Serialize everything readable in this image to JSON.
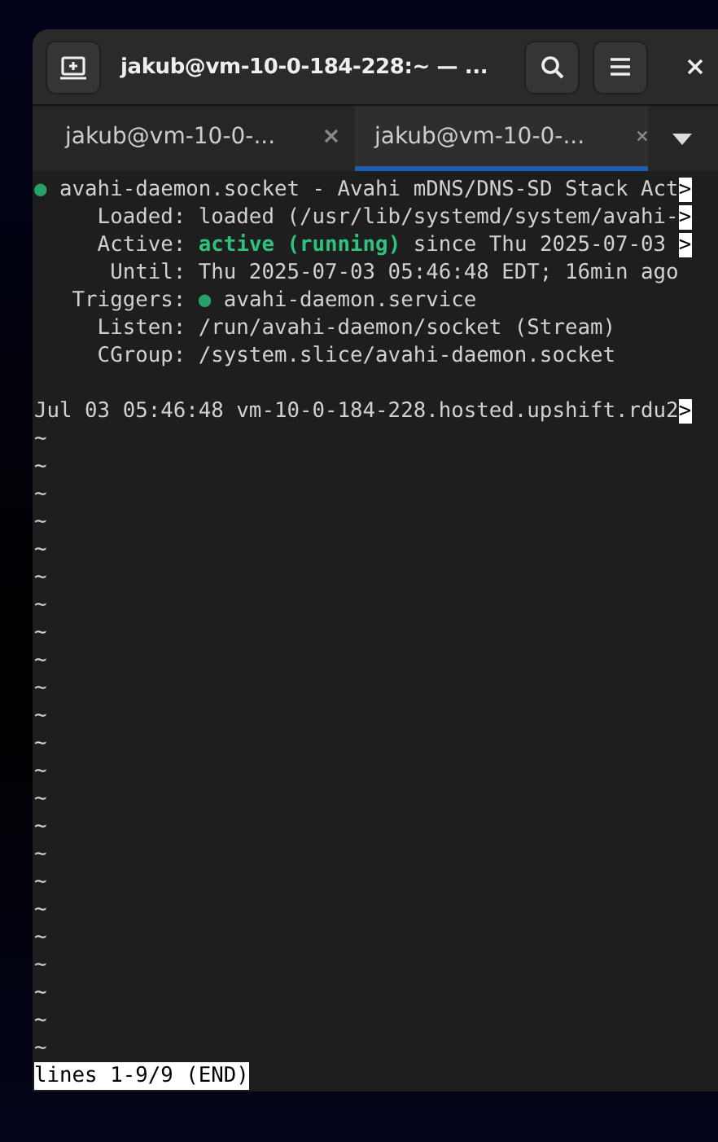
{
  "window": {
    "title": "jakub@vm-10-0-184-228:~ — ..."
  },
  "tabs": [
    {
      "label": "jakub@vm-10-0-...",
      "selected": false
    },
    {
      "label": "jakub@vm-10-0-...",
      "selected": true
    }
  ],
  "terminal": {
    "lines": [
      {
        "segments": [
          {
            "kind": "bullet",
            "text": "●"
          },
          {
            "kind": "plain",
            "text": " avahi-daemon.socket - Avahi mDNS/DNS-SD Stack Act"
          },
          {
            "kind": "marker",
            "text": ">"
          }
        ]
      },
      {
        "segments": [
          {
            "kind": "plain",
            "text": "     Loaded: loaded (/usr/lib/systemd/system/avahi-"
          },
          {
            "kind": "marker",
            "text": ">"
          }
        ]
      },
      {
        "segments": [
          {
            "kind": "plain",
            "text": "     Active: "
          },
          {
            "kind": "status",
            "text": "active (running)"
          },
          {
            "kind": "plain",
            "text": " since Thu 2025-07-03 "
          },
          {
            "kind": "marker",
            "text": ">"
          }
        ]
      },
      {
        "segments": [
          {
            "kind": "plain",
            "text": "      Until: Thu 2025-07-03 05:46:48 EDT; 16min ago"
          }
        ]
      },
      {
        "segments": [
          {
            "kind": "plain",
            "text": "   Triggers: "
          },
          {
            "kind": "bullet",
            "text": "●"
          },
          {
            "kind": "plain",
            "text": " avahi-daemon.service"
          }
        ]
      },
      {
        "segments": [
          {
            "kind": "plain",
            "text": "     Listen: /run/avahi-daemon/socket (Stream)"
          }
        ]
      },
      {
        "segments": [
          {
            "kind": "plain",
            "text": "     CGroup: /system.slice/avahi-daemon.socket"
          }
        ]
      }
    ],
    "log_lines": [
      {
        "segments": [
          {
            "kind": "plain",
            "text": "Jul 03 05:46:48 vm-10-0-184-228.hosted.upshift.rdu2"
          },
          {
            "kind": "marker",
            "text": ">"
          }
        ]
      }
    ],
    "tildes": [
      "~",
      "~",
      "~",
      "~",
      "~",
      "~",
      "~",
      "~",
      "~",
      "~",
      "~",
      "~",
      "~",
      "~",
      "~",
      "~",
      "~",
      "~",
      "~",
      "~",
      "~",
      "~",
      "~"
    ],
    "status": "lines 1-9/9 (END)"
  }
}
